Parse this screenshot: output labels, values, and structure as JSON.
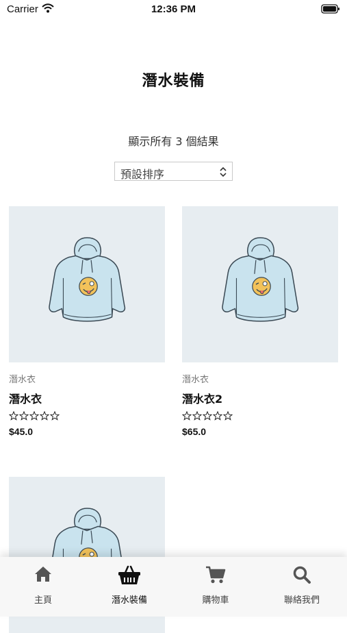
{
  "status_bar": {
    "carrier": "Carrier",
    "time": "12:36 PM"
  },
  "page": {
    "title": "潛水裝備",
    "result_count": "顯示所有 3 個結果"
  },
  "sort": {
    "selected": "預設排序"
  },
  "products": [
    {
      "category": "潛水衣",
      "name": "潛水衣",
      "price": "$45.0",
      "rating": 0
    },
    {
      "category": "潛水衣",
      "name": "潛水衣2",
      "price": "$65.0",
      "rating": 0
    },
    {
      "category": "",
      "name": "",
      "price": "",
      "rating": 0
    }
  ],
  "tab_bar": {
    "active": "tab-diving-gear",
    "items": [
      {
        "label": "主頁",
        "icon": "home-icon"
      },
      {
        "label": "潛水裝備",
        "icon": "basket-icon"
      },
      {
        "label": "購物車",
        "icon": "cart-icon"
      },
      {
        "label": "聯絡我們",
        "icon": "search-icon"
      }
    ]
  },
  "colors": {
    "thumb_bg": "#e7edf1",
    "hoodie": "#c9e3ee",
    "tab_bar_bg": "#f7f7f7"
  }
}
